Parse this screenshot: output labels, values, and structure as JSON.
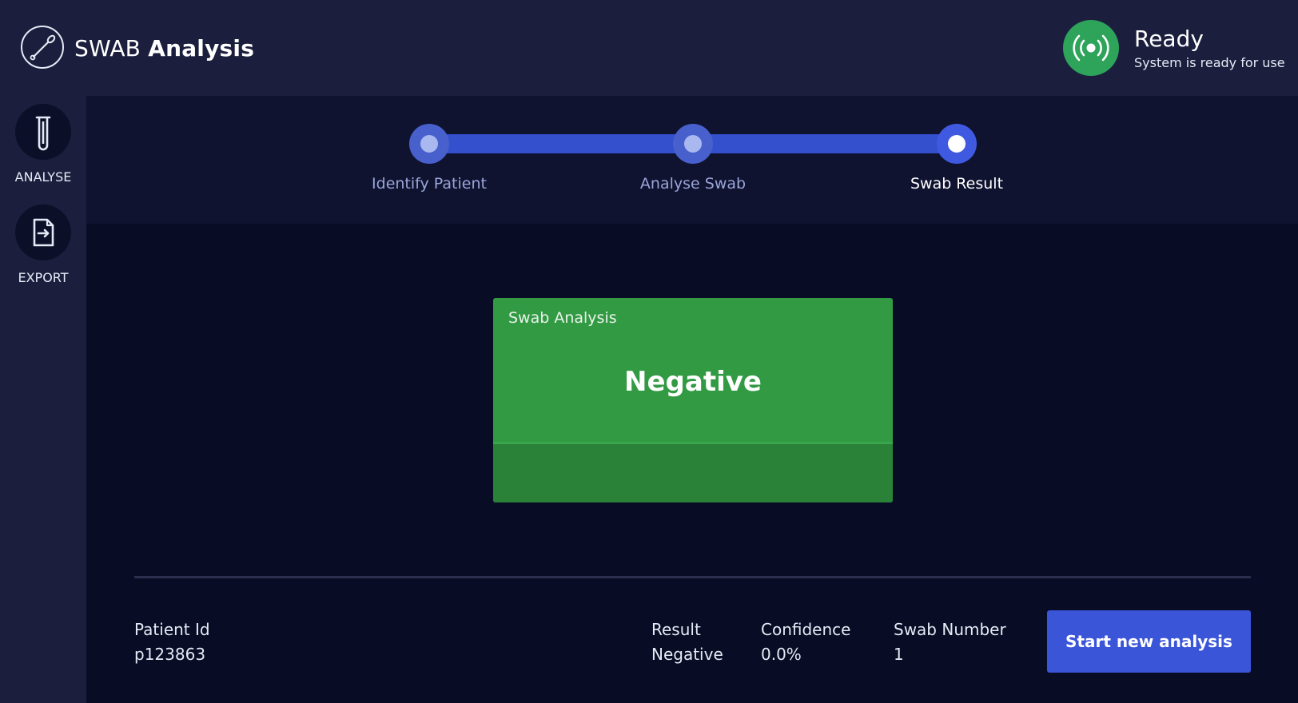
{
  "header": {
    "brand_light": "SWAB",
    "brand_bold": "Analysis",
    "logo_icon": "swab-icon"
  },
  "status": {
    "title": "Ready",
    "subtitle": "System is ready for use",
    "icon": "broadcast-icon",
    "color": "#2ea35a"
  },
  "sidebar": {
    "items": [
      {
        "label": "ANALYSE",
        "icon": "test-tube-icon"
      },
      {
        "label": "EXPORT",
        "icon": "export-file-icon"
      }
    ]
  },
  "stepper": {
    "steps": [
      {
        "label": "Identify Patient",
        "state": "completed"
      },
      {
        "label": "Analyse Swab",
        "state": "completed"
      },
      {
        "label": "Swab Result",
        "state": "active"
      }
    ],
    "accent": "#3450cc"
  },
  "result_card": {
    "title": "Swab Analysis",
    "value": "Negative",
    "color": "#339a44"
  },
  "summary": {
    "patient_id_label": "Patient Id",
    "patient_id_value": "p123863",
    "result_label": "Result",
    "result_value": "Negative",
    "confidence_label": "Confidence",
    "confidence_value": "0.0%",
    "swab_number_label": "Swab Number",
    "swab_number_value": "1"
  },
  "actions": {
    "start_label": "Start new analysis"
  }
}
